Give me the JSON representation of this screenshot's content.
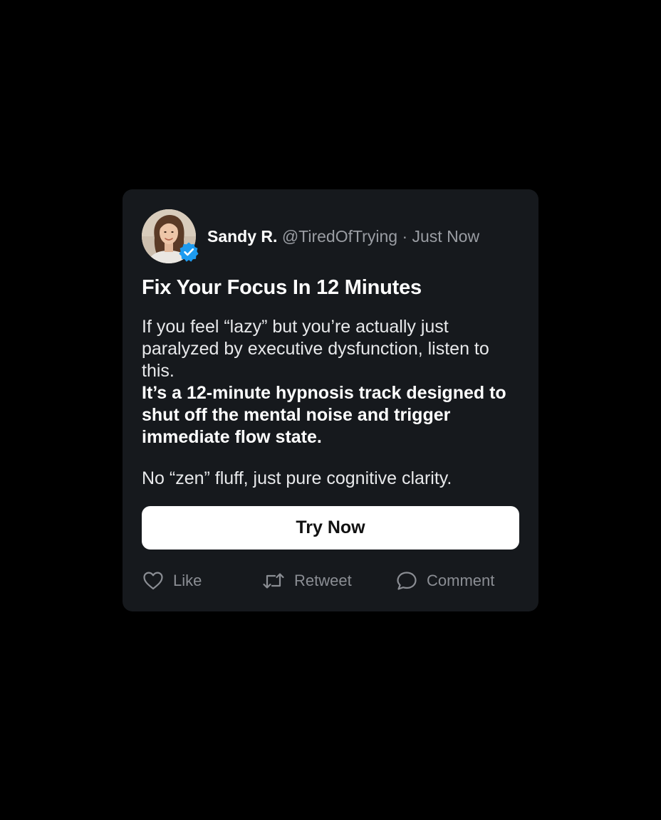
{
  "post": {
    "author": {
      "name": "Sandy R.",
      "handle": "@TiredOfTrying",
      "separator": "·",
      "timestamp": "Just Now",
      "avatar_icon": "user-avatar-photo",
      "verified_icon": "verified-badge-icon"
    },
    "title": "Fix Your Focus In 12 Minutes",
    "body": {
      "intro": "If you feel “lazy” but you’re actually just paralyzed by executive dysfunction, listen to this.",
      "highlight": "It’s a 12-minute hypnosis track designed to shut off the mental noise and trigger immediate flow state.",
      "closing": "No “zen” fluff, just pure cognitive clarity."
    },
    "cta_label": "Try Now",
    "actions": [
      {
        "label": "Like",
        "icon": "heart-icon"
      },
      {
        "label": "Retweet",
        "icon": "retweet-icon"
      },
      {
        "label": "Comment",
        "icon": "comment-icon"
      }
    ]
  },
  "colors": {
    "page_background": "#000000",
    "card_background": "#16191d",
    "primary_text": "#ffffff",
    "secondary_text": "#9a9da3",
    "verified_blue": "#1d9bf0",
    "button_background": "#ffffff",
    "button_text": "#111111"
  }
}
